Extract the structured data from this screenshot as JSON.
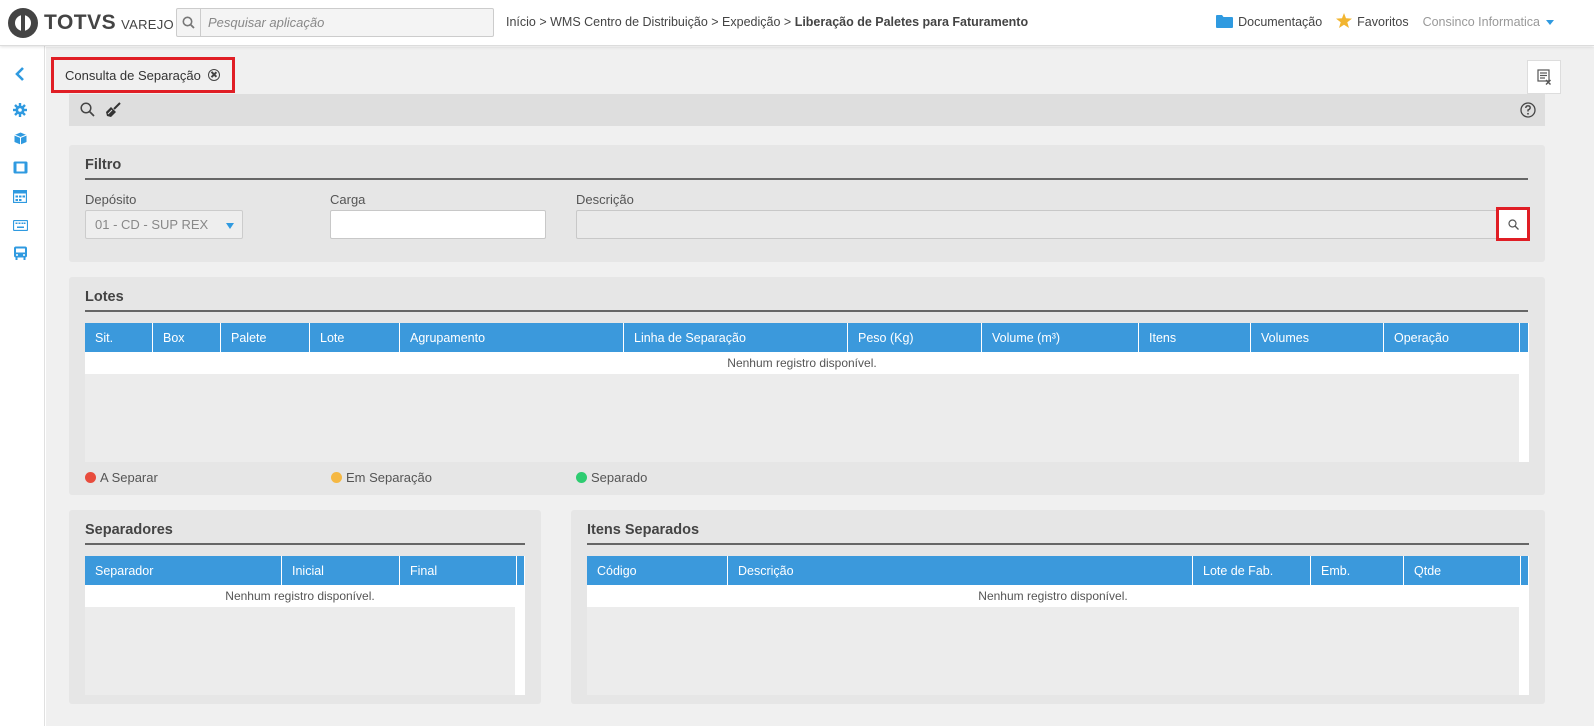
{
  "header": {
    "brand": "TOTVS",
    "brand_sub": "VAREJO",
    "search_placeholder": "Pesquisar aplicação",
    "breadcrumb": {
      "path": "Início > WMS Centro de Distribuição > Expedição > ",
      "current": "Liberação de Paletes para Faturamento"
    },
    "docs_label": "Documentação",
    "favorites_label": "Favoritos",
    "user_label": "Consinco Informatica",
    "accent_color": "#2f9ae0",
    "star_color": "#f2b530"
  },
  "sidebar": {
    "items": [
      "collapse-icon",
      "gear-icon",
      "cube-icon",
      "film-icon",
      "calendar-grid-icon",
      "keyboard-icon",
      "bus-icon"
    ]
  },
  "tab": {
    "label": "Consulta de Separação"
  },
  "filtro": {
    "title": "Filtro",
    "deposito_label": "Depósito",
    "deposito_value": "01 - CD - SUP REX",
    "carga_label": "Carga",
    "carga_value": "",
    "descricao_label": "Descrição",
    "descricao_value": ""
  },
  "lotes": {
    "title": "Lotes",
    "columns": [
      "Sit.",
      "Box",
      "Palete",
      "Lote",
      "Agrupamento",
      "Linha de Separação",
      "Peso (Kg)",
      "Volume (m³)",
      "Itens",
      "Volumes",
      "Operação"
    ],
    "empty_message": "Nenhum registro disponível.",
    "legend": [
      {
        "label": "A Separar",
        "color": "#e84c3d"
      },
      {
        "label": "Em Separação",
        "color": "#f5b843"
      },
      {
        "label": "Separado",
        "color": "#2ecc71"
      }
    ]
  },
  "separadores": {
    "title": "Separadores",
    "columns": [
      "Separador",
      "Inicial",
      "Final"
    ],
    "empty_message": "Nenhum registro disponível."
  },
  "itens": {
    "title": "Itens Separados",
    "columns": [
      "Código",
      "Descrição",
      "Lote de Fab.",
      "Emb.",
      "Qtde"
    ],
    "empty_message": "Nenhum registro disponível."
  },
  "grid_header_color": "#3b99dc",
  "highlight_color": "#e01e25"
}
